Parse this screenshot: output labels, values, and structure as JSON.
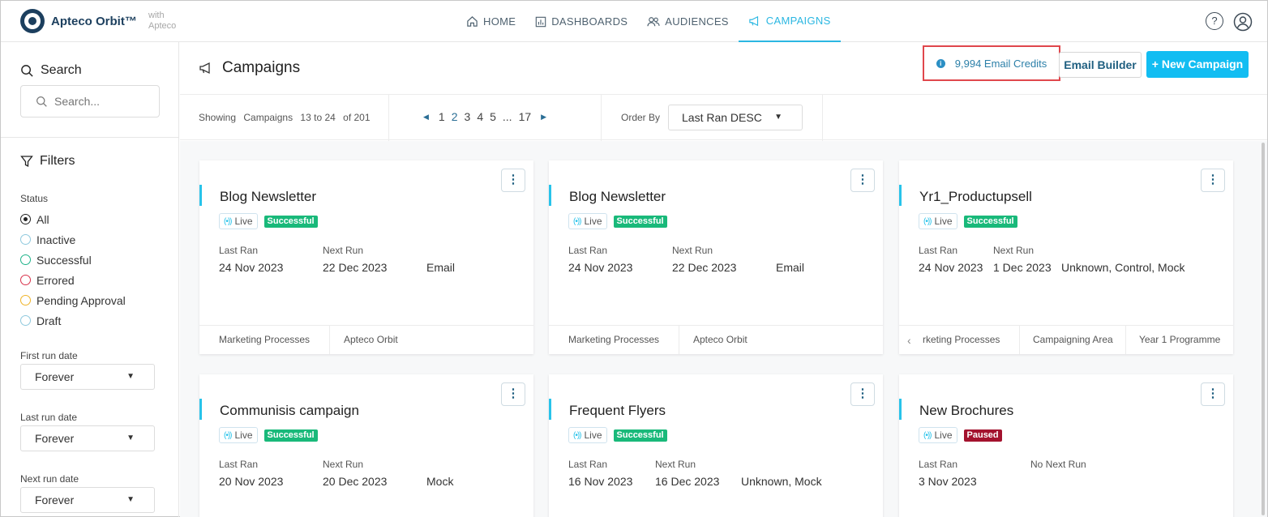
{
  "app": {
    "name": "Apteco Orbit™",
    "with_line1": "with",
    "with_line2": "Apteco"
  },
  "nav": {
    "items": [
      {
        "label": "HOME",
        "icon": "home-icon",
        "active": false
      },
      {
        "label": "DASHBOARDS",
        "icon": "dashboard-icon",
        "active": false
      },
      {
        "label": "AUDIENCES",
        "icon": "audiences-icon",
        "active": false
      },
      {
        "label": "CAMPAIGNS",
        "icon": "campaigns-icon",
        "active": true
      }
    ],
    "help_glyph": "?",
    "active_color": "#2bb7e2"
  },
  "sidebar": {
    "search_title": "Search",
    "search_placeholder": "Search...",
    "filters_title": "Filters",
    "status_label": "Status",
    "status_options": [
      {
        "label": "All",
        "checked": true,
        "color": "#222222"
      },
      {
        "label": "Inactive",
        "checked": false,
        "color": "#8fc9de"
      },
      {
        "label": "Successful",
        "checked": false,
        "color": "#1fb38a"
      },
      {
        "label": "Errored",
        "checked": false,
        "color": "#d9324b"
      },
      {
        "label": "Pending Approval",
        "checked": false,
        "color": "#f0b429"
      },
      {
        "label": "Draft",
        "checked": false,
        "color": "#8fc9de"
      }
    ],
    "first_run_label": "First run date",
    "first_run_value": "Forever",
    "last_run_label": "Last run date",
    "last_run_value": "Forever",
    "next_run_label": "Next run date",
    "next_run_value": "Forever"
  },
  "header": {
    "title": "Campaigns",
    "credits_text": "9,994 Email Credits",
    "email_builder_label": "Email Builder",
    "new_campaign_label": "+ New Campaign"
  },
  "toolbar": {
    "showing_label": "Showing",
    "showing_entity": "Campaigns",
    "showing_range": "13 to 24",
    "showing_total": "of 201",
    "pages": [
      "1",
      "2",
      "3",
      "4",
      "5",
      "...",
      "17"
    ],
    "current_page": "2",
    "order_by_label": "Order By",
    "order_by_value": "Last Ran DESC"
  },
  "cards": [
    {
      "title": "Blog Newsletter",
      "live": "Live",
      "status": "Successful",
      "status_color": "#19b97a",
      "last_ran_label": "Last Ran",
      "last_ran": "24 Nov 2023",
      "next_run_label": "Next Run",
      "next_run": "22 Dec 2023",
      "channel": "Email",
      "footer": [
        "Marketing Processes",
        "Apteco Orbit"
      ]
    },
    {
      "title": "Blog Newsletter",
      "live": "Live",
      "status": "Successful",
      "status_color": "#19b97a",
      "last_ran_label": "Last Ran",
      "last_ran": "24 Nov 2023",
      "next_run_label": "Next Run",
      "next_run": "22 Dec 2023",
      "channel": "Email",
      "footer": [
        "Marketing Processes",
        "Apteco Orbit"
      ]
    },
    {
      "title": "Yr1_Productupsell",
      "live": "Live",
      "status": "Successful",
      "status_color": "#19b97a",
      "last_ran_label": "Last Ran",
      "last_ran": "24 Nov 2023",
      "next_run_label": "Next Run",
      "next_run": "1 Dec 2023",
      "channel": "Unknown, Control, Mock",
      "footer": [
        "rketing Processes",
        "Campaigning Area",
        "Year 1 Programme"
      ]
    },
    {
      "title": "Communisis campaign",
      "live": "Live",
      "status": "Successful",
      "status_color": "#19b97a",
      "last_ran_label": "Last Ran",
      "last_ran": "20 Nov 2023",
      "next_run_label": "Next Run",
      "next_run": "20 Dec 2023",
      "channel": "Mock",
      "footer": []
    },
    {
      "title": "Frequent Flyers",
      "live": "Live",
      "status": "Successful",
      "status_color": "#19b97a",
      "last_ran_label": "Last Ran",
      "last_ran": "16 Nov 2023",
      "next_run_label": "Next Run",
      "next_run": "16 Dec 2023",
      "channel": "Unknown, Mock",
      "footer": []
    },
    {
      "title": "New Brochures",
      "live": "Live",
      "status": "Paused",
      "status_color": "#a3122e",
      "last_ran_label": "Last Ran",
      "last_ran": "3 Nov 2023",
      "next_run_label": "No Next Run",
      "next_run": "",
      "channel": "",
      "footer": []
    }
  ]
}
